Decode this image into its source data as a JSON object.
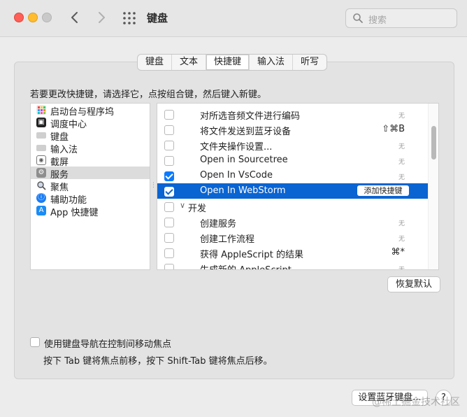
{
  "window": {
    "title": "键盘",
    "search_placeholder": "搜索"
  },
  "tabs": [
    {
      "label": "键盘",
      "active": false
    },
    {
      "label": "文本",
      "active": false
    },
    {
      "label": "快捷键",
      "active": true
    },
    {
      "label": "输入法",
      "active": false
    },
    {
      "label": "听写",
      "active": false
    }
  ],
  "instruction": "若要更改快捷键，请选择它，点按组合键，然后键入新键。",
  "categories": [
    {
      "label": "启动台与程序坞",
      "icon": "launchpad-icon",
      "selected": false
    },
    {
      "label": "调度中心",
      "icon": "mission-control-icon",
      "selected": false
    },
    {
      "label": "键盘",
      "icon": "keyboard-icon",
      "selected": false
    },
    {
      "label": "输入法",
      "icon": "input-source-icon",
      "selected": false
    },
    {
      "label": "截屏",
      "icon": "screenshot-icon",
      "selected": false
    },
    {
      "label": "服务",
      "icon": "gear-icon",
      "selected": true
    },
    {
      "label": "聚焦",
      "icon": "spotlight-icon",
      "selected": false
    },
    {
      "label": "辅助功能",
      "icon": "accessibility-icon",
      "selected": false
    },
    {
      "label": "App 快捷键",
      "icon": "app-store-icon",
      "selected": false
    }
  ],
  "services": [
    {
      "name": "对所选音频文件进行编码",
      "checked": false,
      "shortcut": "无",
      "type": "item"
    },
    {
      "name": "将文件发送到蓝牙设备",
      "checked": false,
      "shortcut": "⇧⌘B",
      "type": "item"
    },
    {
      "name": "文件夹操作设置...",
      "checked": false,
      "shortcut": "无",
      "type": "item"
    },
    {
      "name": "Open in Sourcetree",
      "checked": false,
      "shortcut": "无",
      "type": "item"
    },
    {
      "name": "Open In VsCode",
      "checked": true,
      "shortcut": "无",
      "type": "item"
    },
    {
      "name": "Open In WebStorm",
      "checked": true,
      "shortcut": "",
      "type": "item",
      "selected": true,
      "button": "添加快捷键"
    },
    {
      "name": "开发",
      "checked": false,
      "shortcut": "",
      "type": "group"
    },
    {
      "name": "创建服务",
      "checked": false,
      "shortcut": "无",
      "type": "item"
    },
    {
      "name": "创建工作流程",
      "checked": false,
      "shortcut": "无",
      "type": "item"
    },
    {
      "name": "获得 AppleScript 的结果",
      "checked": false,
      "shortcut": "⌘*",
      "type": "item"
    },
    {
      "name": "生成新的 AppleScript",
      "checked": false,
      "shortcut": "无",
      "type": "item"
    }
  ],
  "restore_label": "恢复默认",
  "kbnav_label": "使用键盘导航在控制间移动焦点",
  "kbnav_hint": "按下 Tab 键将焦点前移，按下 Shift-Tab 键将焦点后移。",
  "bluetooth_label": "设置蓝牙键盘...",
  "help_label": "?",
  "watermark": "@稀土掘金技术社区"
}
